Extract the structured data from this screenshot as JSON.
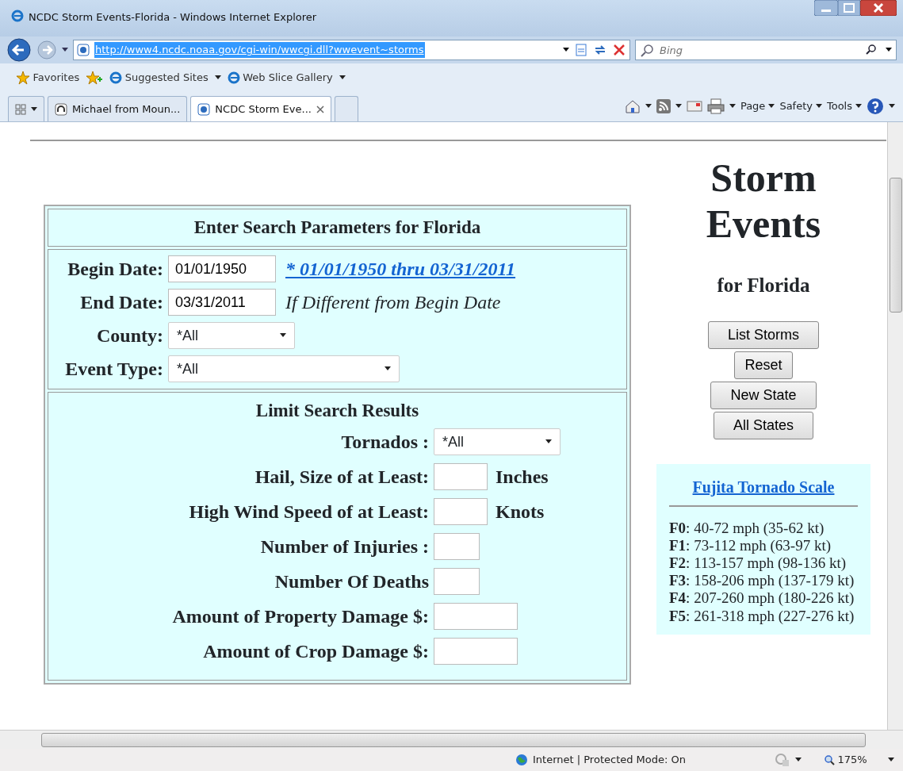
{
  "window": {
    "title": "NCDC Storm Events-Florida - Windows Internet Explorer"
  },
  "address_bar": {
    "url": "http://www4.ncdc.noaa.gov/cgi-win/wwcgi.dll?wwevent~storms"
  },
  "search": {
    "placeholder": "Bing"
  },
  "favorites_bar": {
    "favorites": "Favorites",
    "links": [
      "Suggested Sites",
      "Web Slice Gallery"
    ]
  },
  "tabs": [
    {
      "label": "Michael from Moun...",
      "selected": false
    },
    {
      "label": "NCDC Storm Eve...",
      "selected": true
    }
  ],
  "command_bar": [
    "Page",
    "Safety",
    "Tools"
  ],
  "form": {
    "heading": "Enter Search Parameters for Florida",
    "fields": [
      {
        "label": "Begin Date:",
        "kind": "text",
        "value": "01/01/1950",
        "note": {
          "text": "* 01/01/1950 thru 03/31/2011",
          "kind": "link"
        }
      },
      {
        "label": "End Date:",
        "kind": "text",
        "value": "03/31/2011",
        "note": {
          "text": "If Different from Begin Date",
          "kind": "hint"
        }
      },
      {
        "label": "County:",
        "kind": "select",
        "value": "*All"
      },
      {
        "label": "Event Type:",
        "kind": "wide-select",
        "value": "*All"
      }
    ],
    "limit_heading": "Limit Search Results",
    "limits": [
      {
        "label": "Tornados :",
        "kind": "select",
        "value": "*All"
      },
      {
        "label": "Hail, Size of at Least:",
        "kind": "medium",
        "unit": "Inches"
      },
      {
        "label": "High Wind Speed of at Least:",
        "kind": "medium",
        "unit": "Knots"
      },
      {
        "label": "Number of Injuries :",
        "kind": "short"
      },
      {
        "label": "Number Of Deaths",
        "kind": "short"
      },
      {
        "label": "Amount of Property Damage $:",
        "kind": "long"
      },
      {
        "label": "Amount of Crop Damage $:",
        "kind": "long"
      }
    ]
  },
  "sidebar": {
    "title": [
      "Storm",
      "Events"
    ],
    "subtitle": "for Florida",
    "buttons": [
      "List Storms",
      "Reset",
      "New State",
      "All States"
    ],
    "scale": {
      "link": "Fujita Tornado Scale",
      "items": [
        "**F0**: 40-72 mph (35-62 kt)",
        "**F1**: 73-112 mph (63-97 kt)",
        "**F2**: 113-157 mph (98-136 kt)",
        "**F3**: 158-206 mph (137-179 kt)",
        "**F4**: 207-260 mph (180-226 kt)",
        "**F5**: 261-318 mph (227-276 kt)"
      ]
    }
  },
  "status_bar": {
    "zone": "Internet | Protected Mode: On",
    "zoom": "175%"
  }
}
